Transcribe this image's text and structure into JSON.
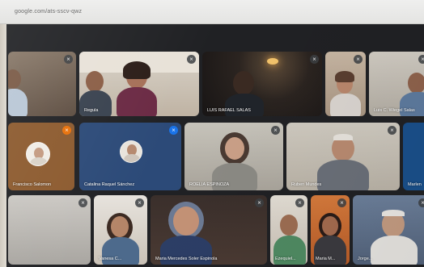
{
  "browser": {
    "url": "google.com/ats-sscv-qwz"
  },
  "meeting": {
    "participants": [
      {
        "name": ""
      },
      {
        "name": "Regula"
      },
      {
        "name": "LUIS RAFAEL SALAS"
      },
      {
        "name": ""
      },
      {
        "name": "Luis C. Wiegel Salas"
      },
      {
        "name": "Francisco Salomon"
      },
      {
        "name": "Catalina Raquel Sánchez"
      },
      {
        "name": "ROELIA ESPINOZA"
      },
      {
        "name": "Ruben Mundes"
      },
      {
        "name": "Marlen"
      },
      {
        "name": ""
      },
      {
        "name": "Vanesa C..."
      },
      {
        "name": "Maria Mercedes Soler Espinola"
      },
      {
        "name": "Ezequiel..."
      },
      {
        "name": "Maria M..."
      },
      {
        "name": "Jorge..."
      }
    ]
  }
}
